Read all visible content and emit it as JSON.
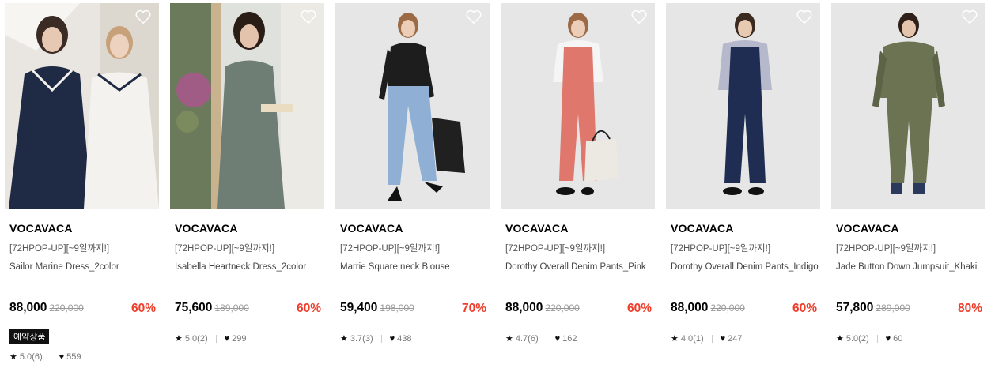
{
  "products": [
    {
      "brand": "VOCAVACA",
      "promo": "[72HPOP-UP][~9일까지!]",
      "name": "Sailor Marine Dress_2color",
      "price": "88,000",
      "original_price": "220,000",
      "discount": "60%",
      "badge": "예약상품",
      "rating": "5.0(6)",
      "likes": "559",
      "colors": {
        "bg": "#e9e6e1",
        "primary": "#1f2a44",
        "secondary": "#f4f2ee"
      }
    },
    {
      "brand": "VOCAVACA",
      "promo": "[72HPOP-UP][~9일까지!]",
      "name": "Isabella Heartneck Dress_2color",
      "price": "75,600",
      "original_price": "189,000",
      "discount": "60%",
      "badge": "",
      "rating": "5.0(2)",
      "likes": "299",
      "colors": {
        "bg": "#dfe1dc",
        "primary": "#6f7e74",
        "secondary": "#8c9a7c"
      }
    },
    {
      "brand": "VOCAVACA",
      "promo": "[72HPOP-UP][~9일까지!]",
      "name": "Marrie Square neck Blouse",
      "price": "59,400",
      "original_price": "198,000",
      "discount": "70%",
      "badge": "",
      "rating": "3.7(3)",
      "likes": "438",
      "colors": {
        "bg": "#e6e6e6",
        "primary": "#1d1d1d",
        "secondary": "#8fb0d4"
      }
    },
    {
      "brand": "VOCAVACA",
      "promo": "[72HPOP-UP][~9일까지!]",
      "name": "Dorothy Overall Denim Pants_Pink",
      "price": "88,000",
      "original_price": "220,000",
      "discount": "60%",
      "badge": "",
      "rating": "4.7(6)",
      "likes": "162",
      "colors": {
        "bg": "#e6e6e6",
        "primary": "#e0776d",
        "secondary": "#f5f5f5"
      }
    },
    {
      "brand": "VOCAVACA",
      "promo": "[72HPOP-UP][~9일까지!]",
      "name": "Dorothy Overall Denim Pants_Indigo",
      "price": "88,000",
      "original_price": "220,000",
      "discount": "60%",
      "badge": "",
      "rating": "4.0(1)",
      "likes": "247",
      "colors": {
        "bg": "#e6e6e6",
        "primary": "#1f2d52",
        "secondary": "#b6b9cc"
      }
    },
    {
      "brand": "VOCAVACA",
      "promo": "[72HPOP-UP][~9일까지!]",
      "name": "Jade Button Down Jumpsuit_Khaki",
      "price": "57,800",
      "original_price": "289,000",
      "discount": "80%",
      "badge": "",
      "rating": "5.0(2)",
      "likes": "60",
      "colors": {
        "bg": "#e6e6e6",
        "primary": "#6b7352",
        "secondary": "#5c6347"
      }
    }
  ],
  "icons": {
    "wishlist": "heart-outline-icon",
    "rating": "star-icon",
    "likes": "heart-filled-icon"
  },
  "accent": {
    "discount": "#ef3d2c",
    "badge_bg": "#111111"
  }
}
